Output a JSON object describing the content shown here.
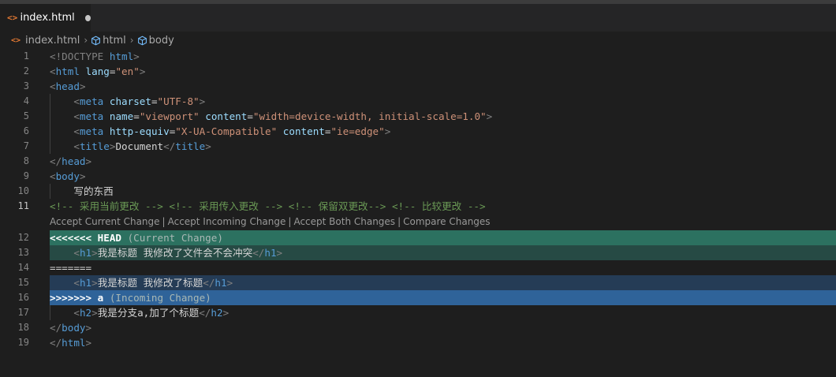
{
  "tab": {
    "icon": "<>",
    "label": "index.html",
    "modified_dot": "unsaved-dot"
  },
  "breadcrumb": {
    "file": "index.html",
    "items": [
      "html",
      "body"
    ]
  },
  "editor": {
    "codelens": [
      "Accept Current Change",
      "Accept Incoming Change",
      "Accept Both Changes",
      "Compare Changes"
    ],
    "lines": [
      {
        "n": "1",
        "bg": "",
        "tokens": [
          [
            "<!DOCTYPE ",
            "br"
          ],
          [
            "html",
            "tag"
          ],
          [
            ">",
            "br"
          ]
        ]
      },
      {
        "n": "2",
        "bg": "",
        "tokens": [
          [
            "<",
            "br"
          ],
          [
            "html",
            "tag"
          ],
          [
            " ",
            "txt"
          ],
          [
            "lang",
            "attr"
          ],
          [
            "=",
            "txt"
          ],
          [
            "\"en\"",
            "str"
          ],
          [
            ">",
            "br"
          ]
        ]
      },
      {
        "n": "3",
        "bg": "",
        "tokens": [
          [
            "<",
            "br"
          ],
          [
            "head",
            "tag"
          ],
          [
            ">",
            "br"
          ]
        ]
      },
      {
        "n": "4",
        "bg": "",
        "indent": true,
        "tokens": [
          [
            "    ",
            "txt"
          ],
          [
            "<",
            "br"
          ],
          [
            "meta",
            "tag"
          ],
          [
            " ",
            "txt"
          ],
          [
            "charset",
            "attr"
          ],
          [
            "=",
            "txt"
          ],
          [
            "\"UTF-8\"",
            "str"
          ],
          [
            ">",
            "br"
          ]
        ]
      },
      {
        "n": "5",
        "bg": "",
        "indent": true,
        "tokens": [
          [
            "    ",
            "txt"
          ],
          [
            "<",
            "br"
          ],
          [
            "meta",
            "tag"
          ],
          [
            " ",
            "txt"
          ],
          [
            "name",
            "attr"
          ],
          [
            "=",
            "txt"
          ],
          [
            "\"viewport\"",
            "str"
          ],
          [
            " ",
            "txt"
          ],
          [
            "content",
            "attr"
          ],
          [
            "=",
            "txt"
          ],
          [
            "\"width=device-width, initial-scale=1.0\"",
            "str"
          ],
          [
            ">",
            "br"
          ]
        ]
      },
      {
        "n": "6",
        "bg": "",
        "indent": true,
        "tokens": [
          [
            "    ",
            "txt"
          ],
          [
            "<",
            "br"
          ],
          [
            "meta",
            "tag"
          ],
          [
            " ",
            "txt"
          ],
          [
            "http-equiv",
            "attr"
          ],
          [
            "=",
            "txt"
          ],
          [
            "\"X-UA-Compatible\"",
            "str"
          ],
          [
            " ",
            "txt"
          ],
          [
            "content",
            "attr"
          ],
          [
            "=",
            "txt"
          ],
          [
            "\"ie=edge\"",
            "str"
          ],
          [
            ">",
            "br"
          ]
        ]
      },
      {
        "n": "7",
        "bg": "",
        "indent": true,
        "tokens": [
          [
            "    ",
            "txt"
          ],
          [
            "<",
            "br"
          ],
          [
            "title",
            "tag"
          ],
          [
            ">",
            "br"
          ],
          [
            "Document",
            "txt"
          ],
          [
            "</",
            "br"
          ],
          [
            "title",
            "tag"
          ],
          [
            ">",
            "br"
          ]
        ]
      },
      {
        "n": "8",
        "bg": "",
        "tokens": [
          [
            "</",
            "br"
          ],
          [
            "head",
            "tag"
          ],
          [
            ">",
            "br"
          ]
        ]
      },
      {
        "n": "9",
        "bg": "",
        "tokens": [
          [
            "<",
            "br"
          ],
          [
            "body",
            "tag"
          ],
          [
            ">",
            "br"
          ]
        ]
      },
      {
        "n": "10",
        "bg": "",
        "indent": true,
        "tokens": [
          [
            "    ",
            "txt"
          ],
          [
            "写的东西",
            "txt"
          ]
        ]
      },
      {
        "n": "11",
        "bg": "",
        "active": true,
        "lens_after": true,
        "tokens": [
          [
            "<!-- 采用当前更改 --> <!-- 采用传入更改 --> <!-- 保留双更改--> <!-- 比较更改 -->",
            "cmt"
          ]
        ]
      },
      {
        "n": "12",
        "bg": "curhead",
        "tokens": [
          [
            "<<<<<<< HEAD",
            "bold"
          ],
          [
            " (Current Change)",
            "dim"
          ]
        ]
      },
      {
        "n": "13",
        "bg": "curbody",
        "tokens": [
          [
            "    ",
            "txt"
          ],
          [
            "<",
            "br"
          ],
          [
            "h1",
            "tag"
          ],
          [
            ">",
            "br"
          ],
          [
            "我是标题 我修改了文件会不会冲突",
            "txt"
          ],
          [
            "</",
            "br"
          ],
          [
            "h1",
            "tag"
          ],
          [
            ">",
            "br"
          ]
        ]
      },
      {
        "n": "14",
        "bg": "",
        "tokens": [
          [
            "=======",
            "txt"
          ]
        ]
      },
      {
        "n": "15",
        "bg": "incbody",
        "tokens": [
          [
            "    ",
            "txt"
          ],
          [
            "<",
            "br"
          ],
          [
            "h1",
            "tag"
          ],
          [
            ">",
            "br"
          ],
          [
            "我是标题 我修改了标题",
            "txt"
          ],
          [
            "</",
            "br"
          ],
          [
            "h1",
            "tag"
          ],
          [
            ">",
            "br"
          ]
        ]
      },
      {
        "n": "16",
        "bg": "inchead",
        "tokens": [
          [
            ">>>>>>> a",
            "bold"
          ],
          [
            " (Incoming Change)",
            "dim"
          ]
        ]
      },
      {
        "n": "17",
        "bg": "",
        "indent": true,
        "tokens": [
          [
            "    ",
            "txt"
          ],
          [
            "<",
            "br"
          ],
          [
            "h2",
            "tag"
          ],
          [
            ">",
            "br"
          ],
          [
            "我是分支a,加了个标题",
            "txt"
          ],
          [
            "</",
            "br"
          ],
          [
            "h2",
            "tag"
          ],
          [
            ">",
            "br"
          ]
        ]
      },
      {
        "n": "18",
        "bg": "",
        "tokens": [
          [
            "</",
            "br"
          ],
          [
            "body",
            "tag"
          ],
          [
            ">",
            "br"
          ]
        ]
      },
      {
        "n": "19",
        "bg": "",
        "tokens": [
          [
            "</",
            "br"
          ],
          [
            "html",
            "tag"
          ],
          [
            ">",
            "br"
          ]
        ]
      }
    ]
  }
}
